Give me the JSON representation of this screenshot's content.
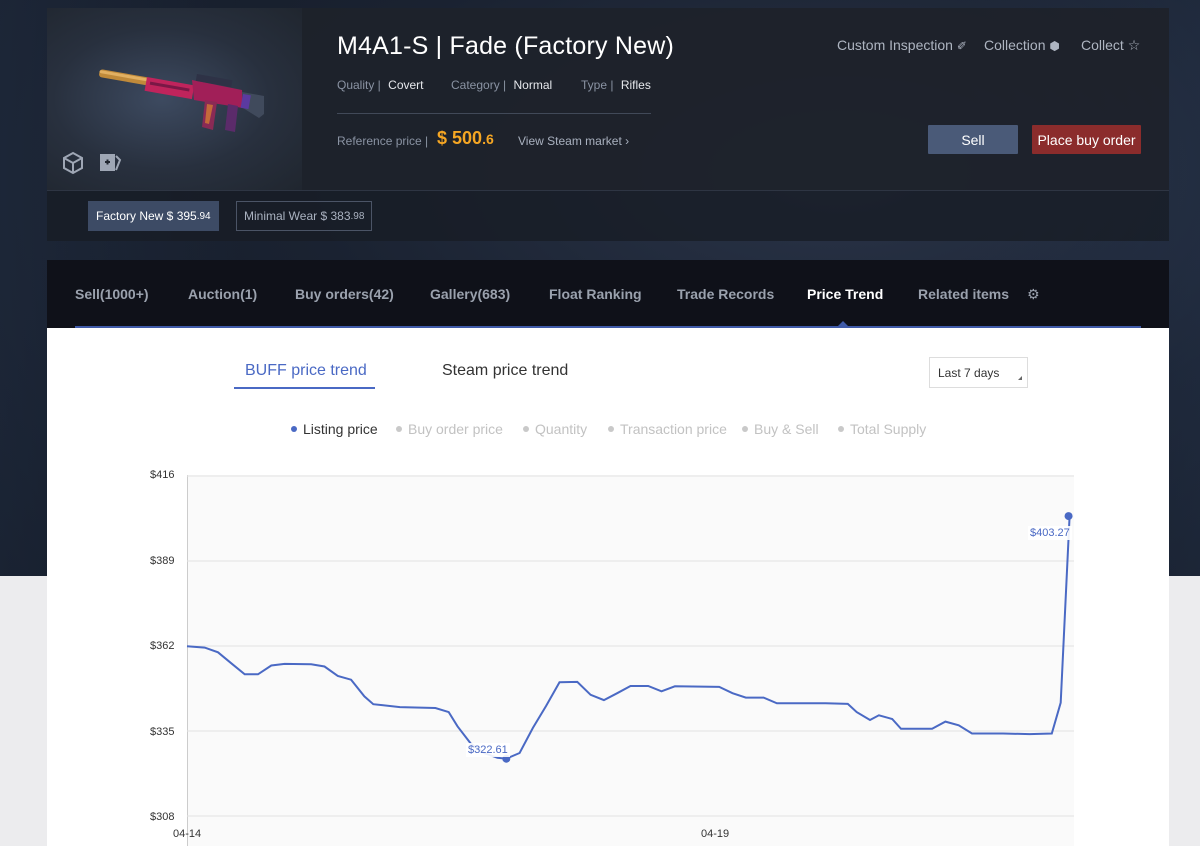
{
  "item": {
    "title": "M4A1-S | Fade (Factory New)",
    "quality_label": "Quality |",
    "quality_value": "Covert",
    "category_label": "Category |",
    "category_value": "Normal",
    "type_label": "Type |",
    "type_value": "Rifles",
    "ref_label": "Reference price |",
    "ref_currency": "$",
    "ref_int": "500",
    "ref_dec": ".6",
    "steam_link": "View Steam market ›"
  },
  "actions": {
    "custom_inspection": "Custom Inspection",
    "collection": "Collection",
    "collect": "Collect",
    "sell": "Sell",
    "buy_order": "Place buy order"
  },
  "wear": [
    {
      "label": "Factory New $ 395",
      "decimal": ".94",
      "active": true
    },
    {
      "label": "Minimal Wear $ 383",
      "decimal": ".98",
      "active": false
    }
  ],
  "tabs": [
    {
      "label": "Sell(1000+)"
    },
    {
      "label": "Auction(1)"
    },
    {
      "label": "Buy orders(42)"
    },
    {
      "label": "Gallery(683)"
    },
    {
      "label": "Float Ranking"
    },
    {
      "label": "Trade Records"
    },
    {
      "label": "Price Trend"
    },
    {
      "label": "Related items"
    }
  ],
  "trend": {
    "buff_tab": "BUFF price trend",
    "steam_tab": "Steam price trend",
    "range": "Last 7 days"
  },
  "legend": [
    "Listing price",
    "Buy order price",
    "Quantity",
    "Transaction price",
    "Buy & Sell",
    "Total Supply"
  ],
  "chart_data": {
    "type": "line",
    "yticks": [
      "$416",
      "$389",
      "$362",
      "$335",
      "$308"
    ],
    "ylim": [
      308,
      416
    ],
    "xticks": [
      "04-14",
      "04-19"
    ],
    "series": [
      {
        "name": "Listing price",
        "color": "#4a69c4",
        "points": [
          [
            0.0,
            361.9
          ],
          [
            0.2,
            361.5
          ],
          [
            0.35,
            360.0
          ],
          [
            0.5,
            356.5
          ],
          [
            0.65,
            353.0
          ],
          [
            0.8,
            353.0
          ],
          [
            0.95,
            355.8
          ],
          [
            1.1,
            356.3
          ],
          [
            1.4,
            356.2
          ],
          [
            1.55,
            355.5
          ],
          [
            1.7,
            352.5
          ],
          [
            1.85,
            351.3
          ],
          [
            2.0,
            346.0
          ],
          [
            2.1,
            343.5
          ],
          [
            2.4,
            342.6
          ],
          [
            2.8,
            342.3
          ],
          [
            2.95,
            341.0
          ],
          [
            3.05,
            336.5
          ],
          [
            3.2,
            331.0
          ],
          [
            3.35,
            328.0
          ],
          [
            3.5,
            326.5
          ],
          [
            3.6,
            326.2
          ],
          [
            3.75,
            328.0
          ],
          [
            3.9,
            336.0
          ],
          [
            4.05,
            343.0
          ],
          [
            4.2,
            350.5
          ],
          [
            4.4,
            350.6
          ],
          [
            4.55,
            346.5
          ],
          [
            4.7,
            344.8
          ],
          [
            4.85,
            347.0
          ],
          [
            5.0,
            349.3
          ],
          [
            5.2,
            349.3
          ],
          [
            5.35,
            347.6
          ],
          [
            5.5,
            349.2
          ],
          [
            6.0,
            349.0
          ],
          [
            6.15,
            347.0
          ],
          [
            6.3,
            345.6
          ],
          [
            6.5,
            345.6
          ],
          [
            6.65,
            343.8
          ],
          [
            7.2,
            343.8
          ],
          [
            7.45,
            343.6
          ],
          [
            7.55,
            341.0
          ],
          [
            7.7,
            338.5
          ],
          [
            7.8,
            340.0
          ],
          [
            7.95,
            338.8
          ],
          [
            8.05,
            335.7
          ],
          [
            8.4,
            335.7
          ],
          [
            8.55,
            338.0
          ],
          [
            8.7,
            336.8
          ],
          [
            8.85,
            334.2
          ],
          [
            9.2,
            334.2
          ],
          [
            9.5,
            334.0
          ],
          [
            9.75,
            334.2
          ],
          [
            9.85,
            344.0
          ],
          [
            9.95,
            403.27
          ]
        ],
        "annotations": [
          {
            "label": "$322.61"
          },
          {
            "label": "$403.27"
          }
        ]
      }
    ]
  }
}
